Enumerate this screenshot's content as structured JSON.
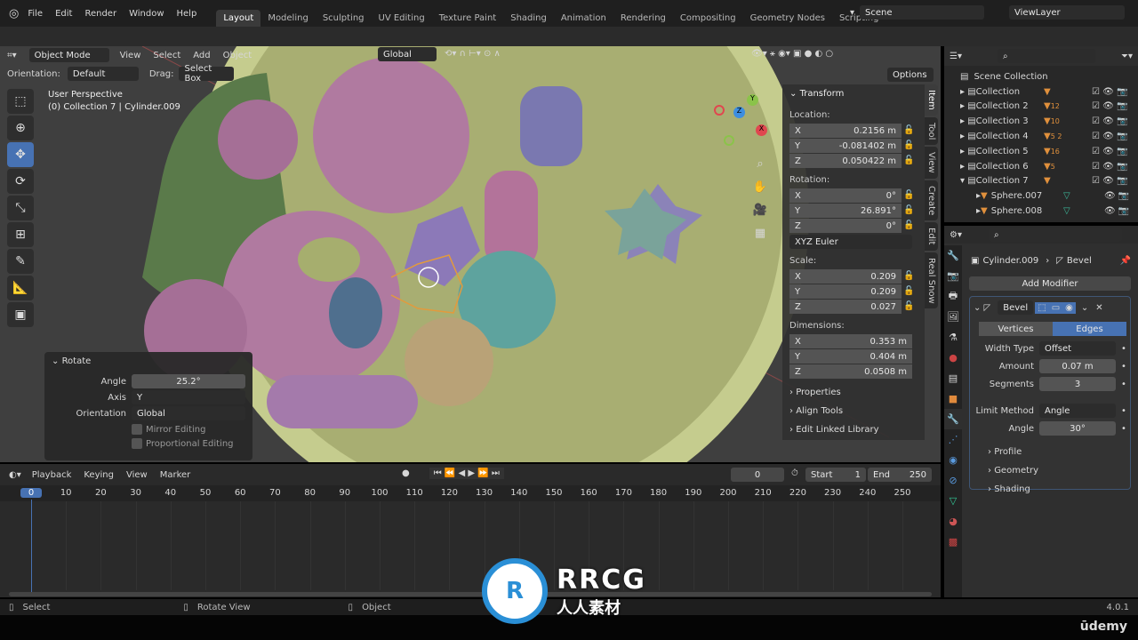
{
  "topbar": {
    "menus": [
      "File",
      "Edit",
      "Render",
      "Window",
      "Help"
    ],
    "workspaces": [
      "Layout",
      "Modeling",
      "Sculpting",
      "UV Editing",
      "Texture Paint",
      "Shading",
      "Animation",
      "Rendering",
      "Compositing",
      "Geometry Nodes",
      "Scripting"
    ],
    "active_workspace": "Layout",
    "scene": "Scene",
    "view_layer": "ViewLayer"
  },
  "viewport": {
    "mode": "Object Mode",
    "menus": [
      "View",
      "Select",
      "Add",
      "Object"
    ],
    "orientation_label": "Orientation:",
    "orientation": "Default",
    "drag_label": "Drag:",
    "drag": "Select Box",
    "transform_orientation": "Global",
    "options": "Options",
    "view_name": "User Perspective",
    "context": "(0) Collection 7 | Cylinder.009",
    "axes": {
      "x": "X",
      "y": "Y",
      "z": "Z"
    },
    "colors": {
      "x": "#e0474f",
      "y": "#8bc34a",
      "z": "#3d8ee0"
    }
  },
  "redo_panel": {
    "title": "Rotate",
    "angle_label": "Angle",
    "angle": "25.2°",
    "axis_label": "Axis",
    "axis": "Y",
    "orientation_label": "Orientation",
    "orientation": "Global",
    "mirror": "Mirror Editing",
    "proportional": "Proportional Editing"
  },
  "npanel": {
    "title": "Transform",
    "location_label": "Location:",
    "location": [
      [
        "X",
        "0.2156 m"
      ],
      [
        "Y",
        "-0.081402 m"
      ],
      [
        "Z",
        "0.050422 m"
      ]
    ],
    "rotation_label": "Rotation:",
    "rotation": [
      [
        "X",
        "0°"
      ],
      [
        "Y",
        "26.891°"
      ],
      [
        "Z",
        "0°"
      ]
    ],
    "rotation_mode": "XYZ Euler",
    "scale_label": "Scale:",
    "scale": [
      [
        "X",
        "0.209"
      ],
      [
        "Y",
        "0.209"
      ],
      [
        "Z",
        "0.027"
      ]
    ],
    "dimensions_label": "Dimensions:",
    "dimensions": [
      [
        "X",
        "0.353 m"
      ],
      [
        "Y",
        "0.404 m"
      ],
      [
        "Z",
        "0.0508 m"
      ]
    ],
    "sections": [
      "Properties",
      "Align Tools",
      "Edit Linked Library"
    ],
    "tabs": [
      "Item",
      "Tool",
      "View",
      "Create",
      "Edit",
      "Real Snow"
    ]
  },
  "outliner": {
    "root": "Scene Collection",
    "items": [
      {
        "name": "Collection",
        "badge": ""
      },
      {
        "name": "Collection 2",
        "badge": "12"
      },
      {
        "name": "Collection 3",
        "badge": "10"
      },
      {
        "name": "Collection 4",
        "badge": "5  2"
      },
      {
        "name": "Collection 5",
        "badge": "16"
      },
      {
        "name": "Collection 6",
        "badge": "5"
      },
      {
        "name": "Collection 7",
        "badge": ""
      }
    ],
    "children": [
      "Sphere.007",
      "Sphere.008"
    ]
  },
  "properties": {
    "object": "Cylinder.009",
    "modifier_crumb": "Bevel",
    "add_modifier": "Add Modifier",
    "modifier_name": "Bevel",
    "affect": [
      "Vertices",
      "Edges"
    ],
    "affect_active": "Edges",
    "fields": [
      [
        "Width Type",
        "Offset"
      ],
      [
        "Amount",
        "0.07 m"
      ],
      [
        "Segments",
        "3"
      ],
      [
        "Limit Method",
        "Angle"
      ],
      [
        "Angle",
        "30°"
      ]
    ],
    "subpanels": [
      "Profile",
      "Geometry",
      "Shading"
    ]
  },
  "timeline": {
    "menus": [
      "Playback",
      "Keying",
      "View",
      "Marker"
    ],
    "current_frame": "0",
    "start_label": "Start",
    "start": "1",
    "end_label": "End",
    "end": "250",
    "ticks": [
      "0",
      "10",
      "20",
      "30",
      "40",
      "50",
      "60",
      "70",
      "80",
      "90",
      "100",
      "110",
      "120",
      "130",
      "140",
      "150",
      "160",
      "170",
      "180",
      "190",
      "200",
      "210",
      "220",
      "230",
      "240",
      "250"
    ]
  },
  "status": {
    "select": "Select",
    "rotate": "Rotate View",
    "object": "Object",
    "version": "4.0.1"
  },
  "watermark": {
    "logo": "RRCG",
    "sub": "人人素材"
  },
  "brand": "ūdemy"
}
